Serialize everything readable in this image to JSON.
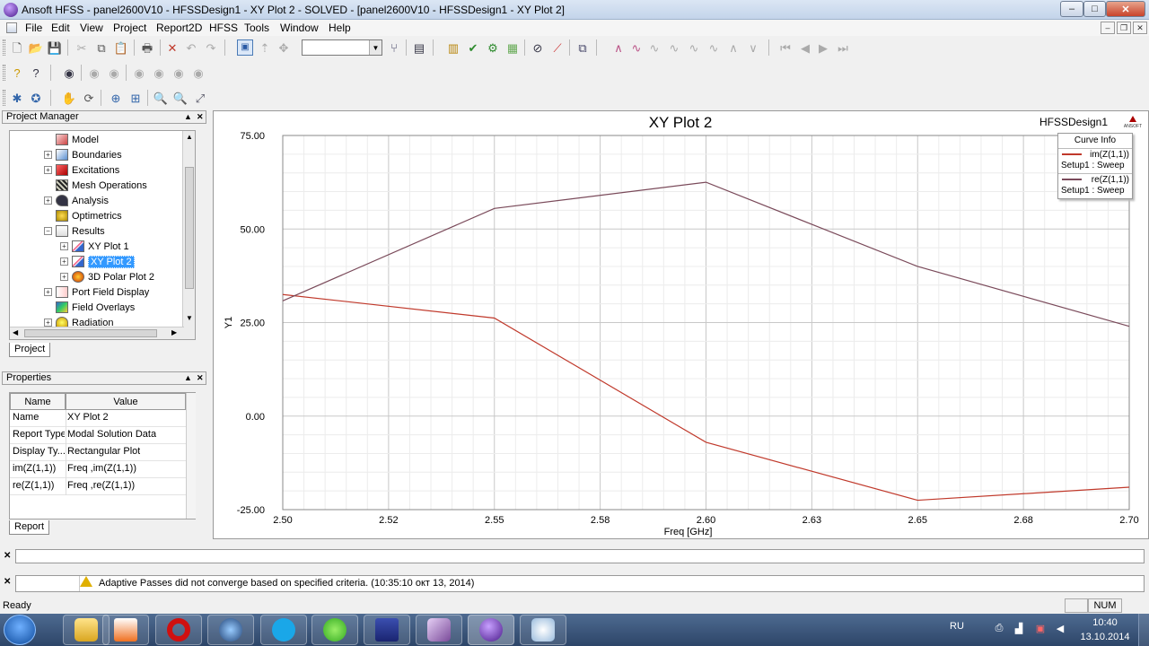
{
  "window": {
    "title": "Ansoft HFSS - panel2600V10 - HFSSDesign1 - XY Plot 2 - SOLVED - [panel2600V10 - HFSSDesign1 - XY Plot 2]",
    "minimize": "–",
    "maximize": "□",
    "close": "✕"
  },
  "menu": [
    "File",
    "Edit",
    "View",
    "Project",
    "Report2D",
    "HFSS",
    "Tools",
    "Window",
    "Help"
  ],
  "project_manager": {
    "header": "Project Manager",
    "tab": "Project",
    "tree": [
      {
        "label": "Model",
        "icon": "model-icon",
        "expander": ""
      },
      {
        "label": "Boundaries",
        "icon": "boundaries-icon",
        "expander": "+"
      },
      {
        "label": "Excitations",
        "icon": "excitations-icon",
        "expander": "+"
      },
      {
        "label": "Mesh Operations",
        "icon": "mesh-operations-icon",
        "expander": ""
      },
      {
        "label": "Analysis",
        "icon": "analysis-icon",
        "expander": "+"
      },
      {
        "label": "Optimetrics",
        "icon": "optimetrics-icon",
        "expander": ""
      },
      {
        "label": "Results",
        "icon": "results-icon",
        "expander": "−"
      },
      {
        "label": "XY Plot 1",
        "icon": "xy-plot-icon",
        "expander": "+"
      },
      {
        "label": "XY Plot 2",
        "icon": "xy-plot-icon",
        "expander": "+"
      },
      {
        "label": "3D Polar Plot 2",
        "icon": "3d-polar-plot-icon",
        "expander": "+"
      },
      {
        "label": "Port Field Display",
        "icon": "port-field-icon",
        "expander": "+"
      },
      {
        "label": "Field Overlays",
        "icon": "field-overlays-icon",
        "expander": ""
      },
      {
        "label": "Radiation",
        "icon": "radiation-icon",
        "expander": "+"
      }
    ]
  },
  "properties": {
    "header": "Properties",
    "tab": "Report",
    "columns": [
      "Name",
      "Value"
    ],
    "rows": [
      {
        "name": "Name",
        "value": "XY Plot 2"
      },
      {
        "name": "Report Type",
        "value": "Modal Solution Data"
      },
      {
        "name": "Display Ty...",
        "value": "Rectangular Plot"
      },
      {
        "name": "im(Z(1,1))",
        "value": "Freq ,im(Z(1,1))"
      },
      {
        "name": "re(Z(1,1))",
        "value": "Freq ,re(Z(1,1))"
      }
    ]
  },
  "plot": {
    "design_name": "HFSSDesign1",
    "logo_text": "ANSOFT",
    "legend_title": "Curve Info"
  },
  "chart_data": {
    "type": "line",
    "title": "XY Plot 2",
    "xlabel": "Freq [GHz]",
    "ylabel": "Y1",
    "xlim": [
      2.5,
      2.7
    ],
    "ylim": [
      -25,
      75
    ],
    "x_ticks": [
      "2.50",
      "2.52",
      "2.55",
      "2.58",
      "2.60",
      "2.63",
      "2.65",
      "2.68",
      "2.70"
    ],
    "y_ticks": [
      "75.00",
      "50.00",
      "25.00",
      "0.00",
      "-25.00"
    ],
    "grid": true,
    "legend_position": "top-right",
    "series": [
      {
        "name": "im(Z(1,1))",
        "setup": "Setup1 : Sweep",
        "color": "#c0392b",
        "x": [
          2.5,
          2.55,
          2.6,
          2.65,
          2.7
        ],
        "y": [
          32.5,
          26.2,
          -7.0,
          -22.5,
          -19.0
        ]
      },
      {
        "name": "re(Z(1,1))",
        "setup": "Setup1 : Sweep",
        "color": "#7a4a5a",
        "x": [
          2.5,
          2.55,
          2.6,
          2.65,
          2.7
        ],
        "y": [
          30.8,
          55.5,
          62.5,
          40.0,
          24.0
        ]
      }
    ]
  },
  "message_bar": {
    "text": "Adaptive Passes did not converge based on specified criteria. (10:35:10 окт 13, 2014)"
  },
  "status": {
    "text": "Ready",
    "num": "NUM"
  },
  "taskbar": {
    "lang": "RU",
    "time": "10:40",
    "date": "13.10.2014"
  }
}
